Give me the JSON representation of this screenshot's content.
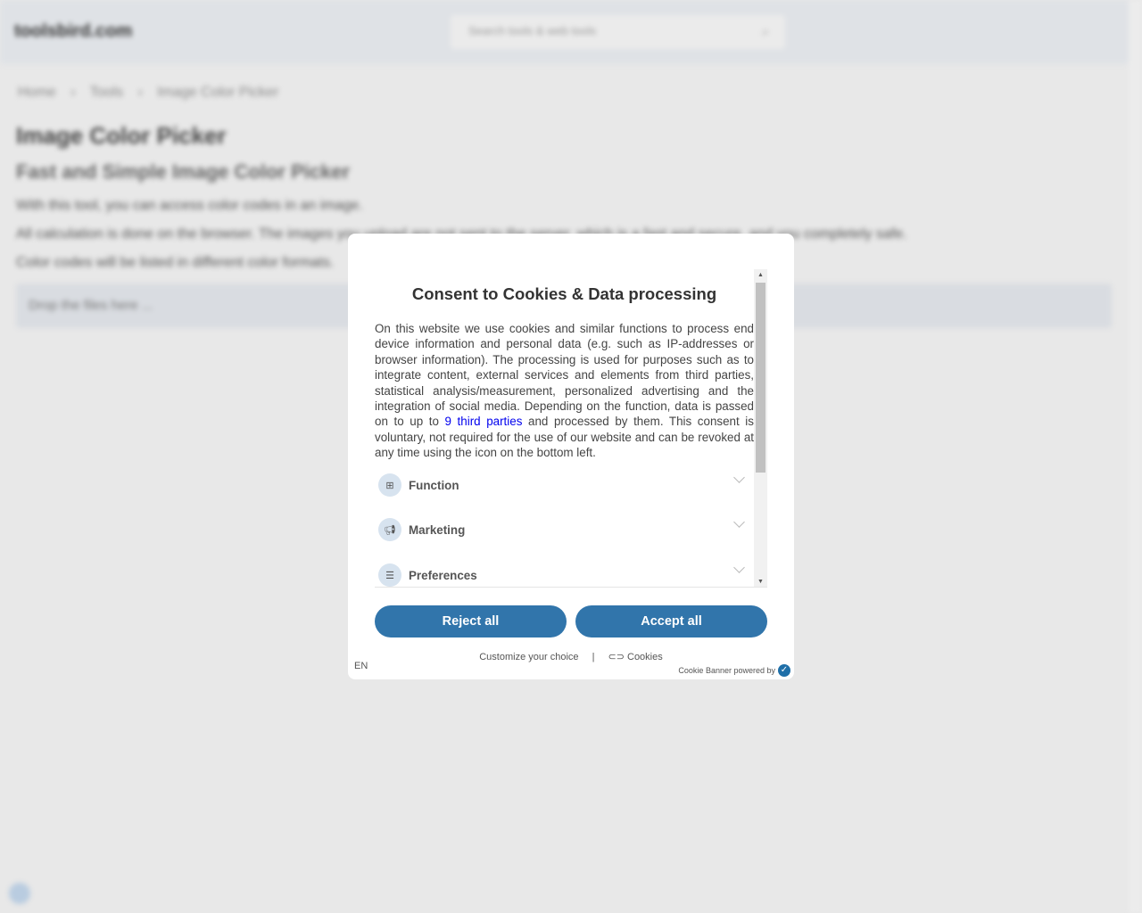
{
  "background": {
    "logo": "toolsbird.com",
    "search_placeholder": "Search tools & web tools",
    "breadcrumb": [
      "Home",
      "›",
      "Tools",
      "›",
      "Image Color Picker"
    ],
    "title": "Image Color Picker",
    "subtitle": "Fast and Simple Image Color Picker",
    "paragraphs": [
      "With this tool, you can access color codes in an image.",
      "All calculation is done on the browser. The images you upload are not sent to the server, which is a fast and secure, and you completely safe.",
      "Color codes will be listed in different color formats."
    ],
    "dropzone": "Drop the files here ..."
  },
  "modal": {
    "title": "Consent to Cookies & Data processing",
    "text_before_link": "On this website we use cookies and similar functions to process end device information and personal data (e.g. such as IP-addresses or browser information). The processing is used for purposes such as to integrate content, external services and elements from third parties, statistical analysis/measurement, personalized advertising and the integration of social media. Depending on the function, data is passed on to up to ",
    "link_text": "9 third parties",
    "text_after_link": " and processed by them. This consent is voluntary, not required for the use of our website and can be revoked at any time using the icon on the bottom left.",
    "categories": [
      {
        "label": "Function",
        "icon": "grid-icon"
      },
      {
        "label": "Marketing",
        "icon": "megaphone-icon"
      },
      {
        "label": "Preferences",
        "icon": "sliders-icon"
      }
    ],
    "reject_label": "Reject all",
    "accept_label": "Accept all",
    "customize_label": "Customize your choice",
    "separator": "|",
    "cookies_label": "Cookies",
    "language": "EN",
    "powered_by": "Cookie Banner powered by",
    "accent_color": "#3175ab"
  }
}
